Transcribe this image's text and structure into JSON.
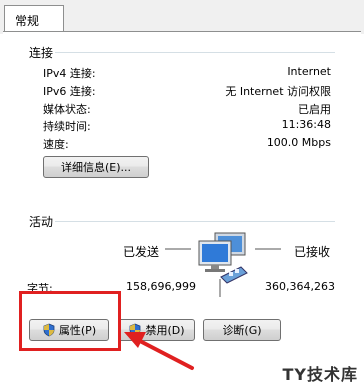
{
  "tabs": [
    {
      "label": "常规"
    }
  ],
  "connection": {
    "title": "连接",
    "rows": [
      {
        "label": "IPv4 连接:",
        "value": "Internet"
      },
      {
        "label": "IPv6 连接:",
        "value": "无 Internet 访问权限"
      },
      {
        "label": "媒体状态:",
        "value": "已启用"
      },
      {
        "label": "持续时间:",
        "value": "11:36:48"
      },
      {
        "label": "速度:",
        "value": "100.0 Mbps"
      }
    ],
    "details_button": "详细信息(E)..."
  },
  "activity": {
    "title": "活动",
    "sent_label": "已发送",
    "received_label": "已接收",
    "bytes_label": "字节:",
    "bytes_sent": "158,696,999",
    "bytes_received": "360,364,263"
  },
  "buttons": {
    "properties": "属性(P)",
    "disable": "禁用(D)",
    "diagnose": "诊断(G)"
  },
  "watermark": "TY技术库",
  "colors": {
    "accent_red": "#e02020",
    "shield_blue": "#2f6fcf",
    "shield_yellow": "#f1c232"
  }
}
